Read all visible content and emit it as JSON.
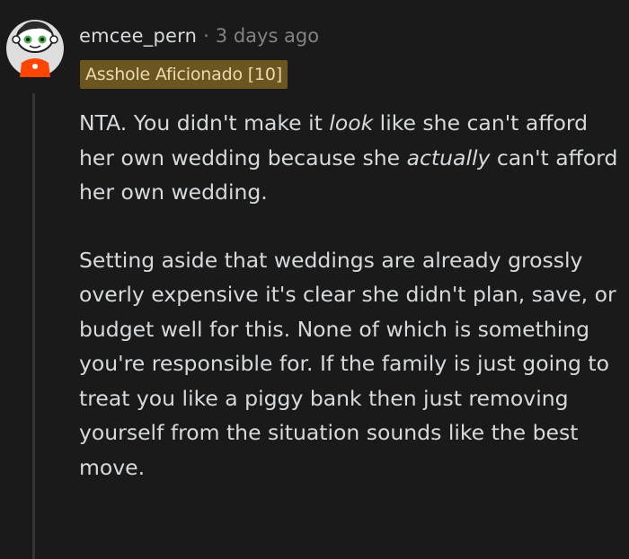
{
  "comment": {
    "username": "emcee_pern",
    "separator": "·",
    "timestamp": "3 days ago",
    "flair": "Asshole Aficionado [10]",
    "paragraph1": {
      "part1": "NTA. You didn't make it ",
      "italic1": "look",
      "part2": " like she can't afford her own wedding because she ",
      "italic2": "actually",
      "part3": " can't afford her own wedding."
    },
    "paragraph2": "Setting aside that weddings are already grossly overly expensive it's clear she didn't plan, save, or budget well for this. None of which is something you're responsible for. If the family is just going to treat you like a piggy bank then just removing yourself from the situation sounds like the best move."
  },
  "colors": {
    "background": "#1a1a1b",
    "text": "#d7dadc",
    "meta": "#818384",
    "flair_bg": "#6b5620",
    "thread_line": "#343536",
    "avatar_accent": "#ff4500"
  },
  "icons": {
    "avatar": "snoo-avatar-icon"
  }
}
